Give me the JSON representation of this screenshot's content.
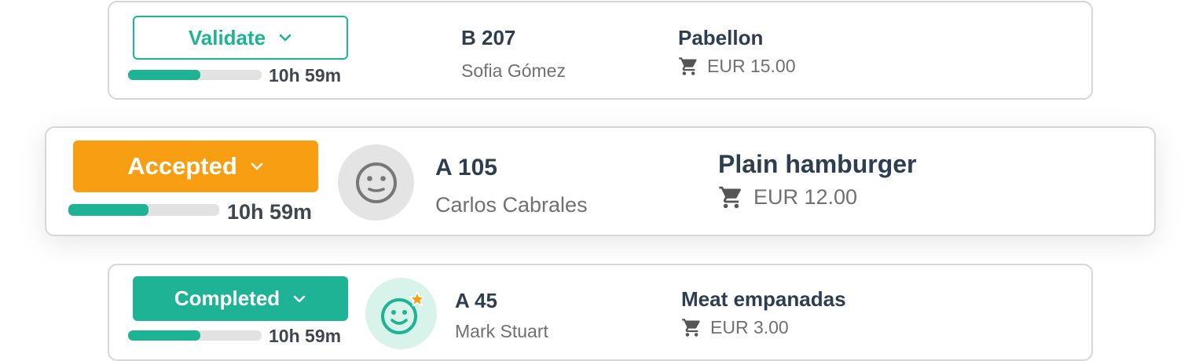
{
  "orders": [
    {
      "status": {
        "label": "Validate",
        "style": "outline",
        "color": "#1db394"
      },
      "timer": "10h 59m",
      "progress": 0.54,
      "location": "B 207",
      "customer": "Sofia Gómez",
      "product": "Pabellon",
      "price": "EUR 15.00"
    },
    {
      "status": {
        "label": "Accepted",
        "style": "filled",
        "color": "#f79e12"
      },
      "timer": "10h 59m",
      "progress": 0.53,
      "avatar": {
        "icon": "neutral-face-icon",
        "background": "#e4e4e4"
      },
      "location": "A 105",
      "customer": "Carlos Cabrales",
      "product": "Plain hamburger",
      "price": "EUR 12.00"
    },
    {
      "status": {
        "label": "Completed",
        "style": "filled",
        "color": "#1db394"
      },
      "timer": "10h 59m",
      "progress": 0.54,
      "avatar": {
        "icon": "smiling-face-star-icon",
        "background": "#d7f3ea"
      },
      "location": "A 45",
      "customer": "Mark Stuart",
      "product": "Meat empanadas",
      "price": "EUR 3.00"
    }
  ],
  "colors": {
    "accent_green": "#1db394",
    "accent_orange": "#f79e12",
    "text_dark": "#2c3e50",
    "text_muted": "#707070",
    "border": "#d6d6d6"
  }
}
